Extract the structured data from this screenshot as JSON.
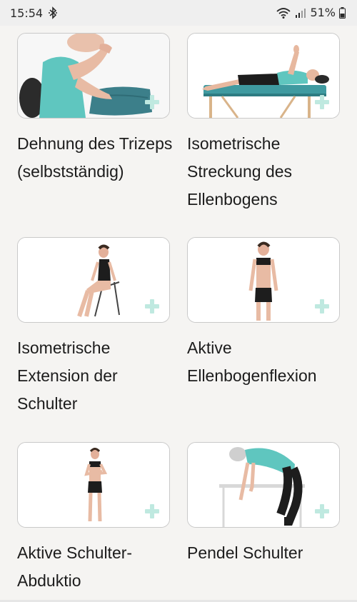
{
  "status_bar": {
    "time": "15:54",
    "battery": "51%"
  },
  "exercises": [
    {
      "title": "Dehnung des Trizeps (selbstständig)"
    },
    {
      "title": "Isometrische Streckung des Ellenbogens"
    },
    {
      "title": "Isometrische Extension der Schulter"
    },
    {
      "title": "Aktive Ellenbogenflexion"
    },
    {
      "title": "Aktive Schulter-Abduktio"
    },
    {
      "title": "Pendel Schulter"
    }
  ],
  "colors": {
    "accent_plus": "#bfe9e0",
    "shirt_teal": "#5fc6bf",
    "background": "#f5f4f2"
  }
}
